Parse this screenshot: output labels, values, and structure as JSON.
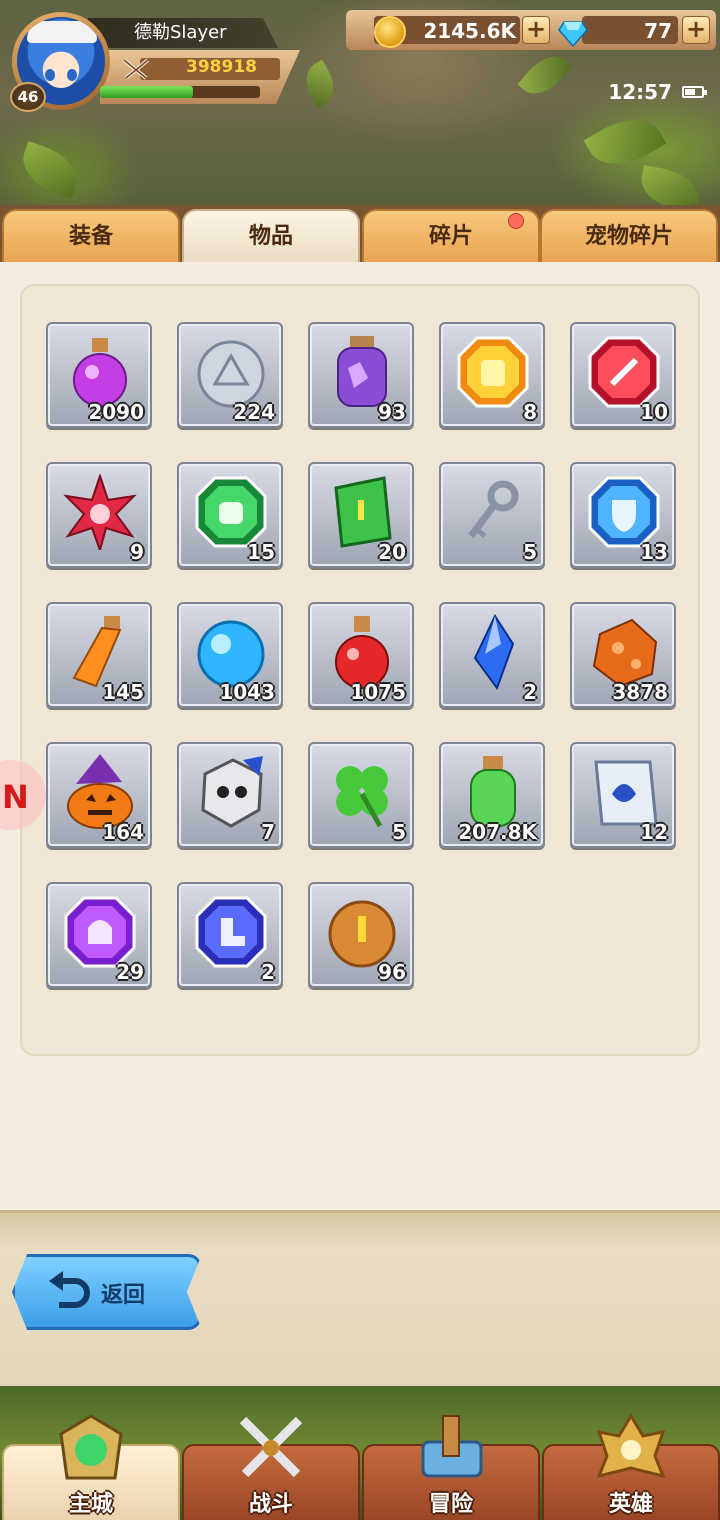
{
  "player": {
    "name": "德勒Slayer",
    "level": "46",
    "power": "398918",
    "exp_fraction": 0.58
  },
  "currency": {
    "gold": "2145.6K",
    "gems": "77",
    "plus_label": "+"
  },
  "status": {
    "time": "12:57"
  },
  "tabs": [
    {
      "label": "装备"
    },
    {
      "label": "物品"
    },
    {
      "label": "碎片"
    },
    {
      "label": "宠物碎片"
    }
  ],
  "active_tab": 1,
  "items": [
    {
      "icon": "purple-potion-icon",
      "count": "2090"
    },
    {
      "icon": "silver-coin-icon",
      "count": "224"
    },
    {
      "icon": "purple-jar-icon",
      "count": "93"
    },
    {
      "icon": "yellow-armor-gem-icon",
      "count": "8"
    },
    {
      "icon": "red-sword-gem-icon",
      "count": "10"
    },
    {
      "icon": "red-star-crystal-icon",
      "count": "9"
    },
    {
      "icon": "green-glove-gem-icon",
      "count": "15"
    },
    {
      "icon": "green-scroll-icon",
      "count": "20"
    },
    {
      "icon": "silver-key-icon",
      "count": "5"
    },
    {
      "icon": "blue-shield-gem-icon",
      "count": "13"
    },
    {
      "icon": "orange-elixir-icon",
      "count": "145"
    },
    {
      "icon": "blue-orb-icon",
      "count": "1043"
    },
    {
      "icon": "red-potion-icon",
      "count": "1075"
    },
    {
      "icon": "blue-crystal-icon",
      "count": "2"
    },
    {
      "icon": "orange-ore-icon",
      "count": "3878"
    },
    {
      "icon": "pumpkin-icon",
      "count": "164"
    },
    {
      "icon": "skull-box-icon",
      "count": "7"
    },
    {
      "icon": "clover-icon",
      "count": "5"
    },
    {
      "icon": "green-bottle-icon",
      "count": "207.8K"
    },
    {
      "icon": "blue-scroll-icon",
      "count": "12"
    },
    {
      "icon": "purple-helmet-gem-icon",
      "count": "29"
    },
    {
      "icon": "blue-boot-gem-icon",
      "count": "2"
    },
    {
      "icon": "bronze-sword-coin-icon",
      "count": "96"
    }
  ],
  "back_button": {
    "label": "返回"
  },
  "bottom_nav": [
    {
      "label": "主城",
      "icon": "main-city-icon"
    },
    {
      "label": "战斗",
      "icon": "crossed-swords-icon"
    },
    {
      "label": "冒险",
      "icon": "adventure-icon"
    },
    {
      "label": "英雄",
      "icon": "hero-icon"
    }
  ],
  "active_nav": 0
}
